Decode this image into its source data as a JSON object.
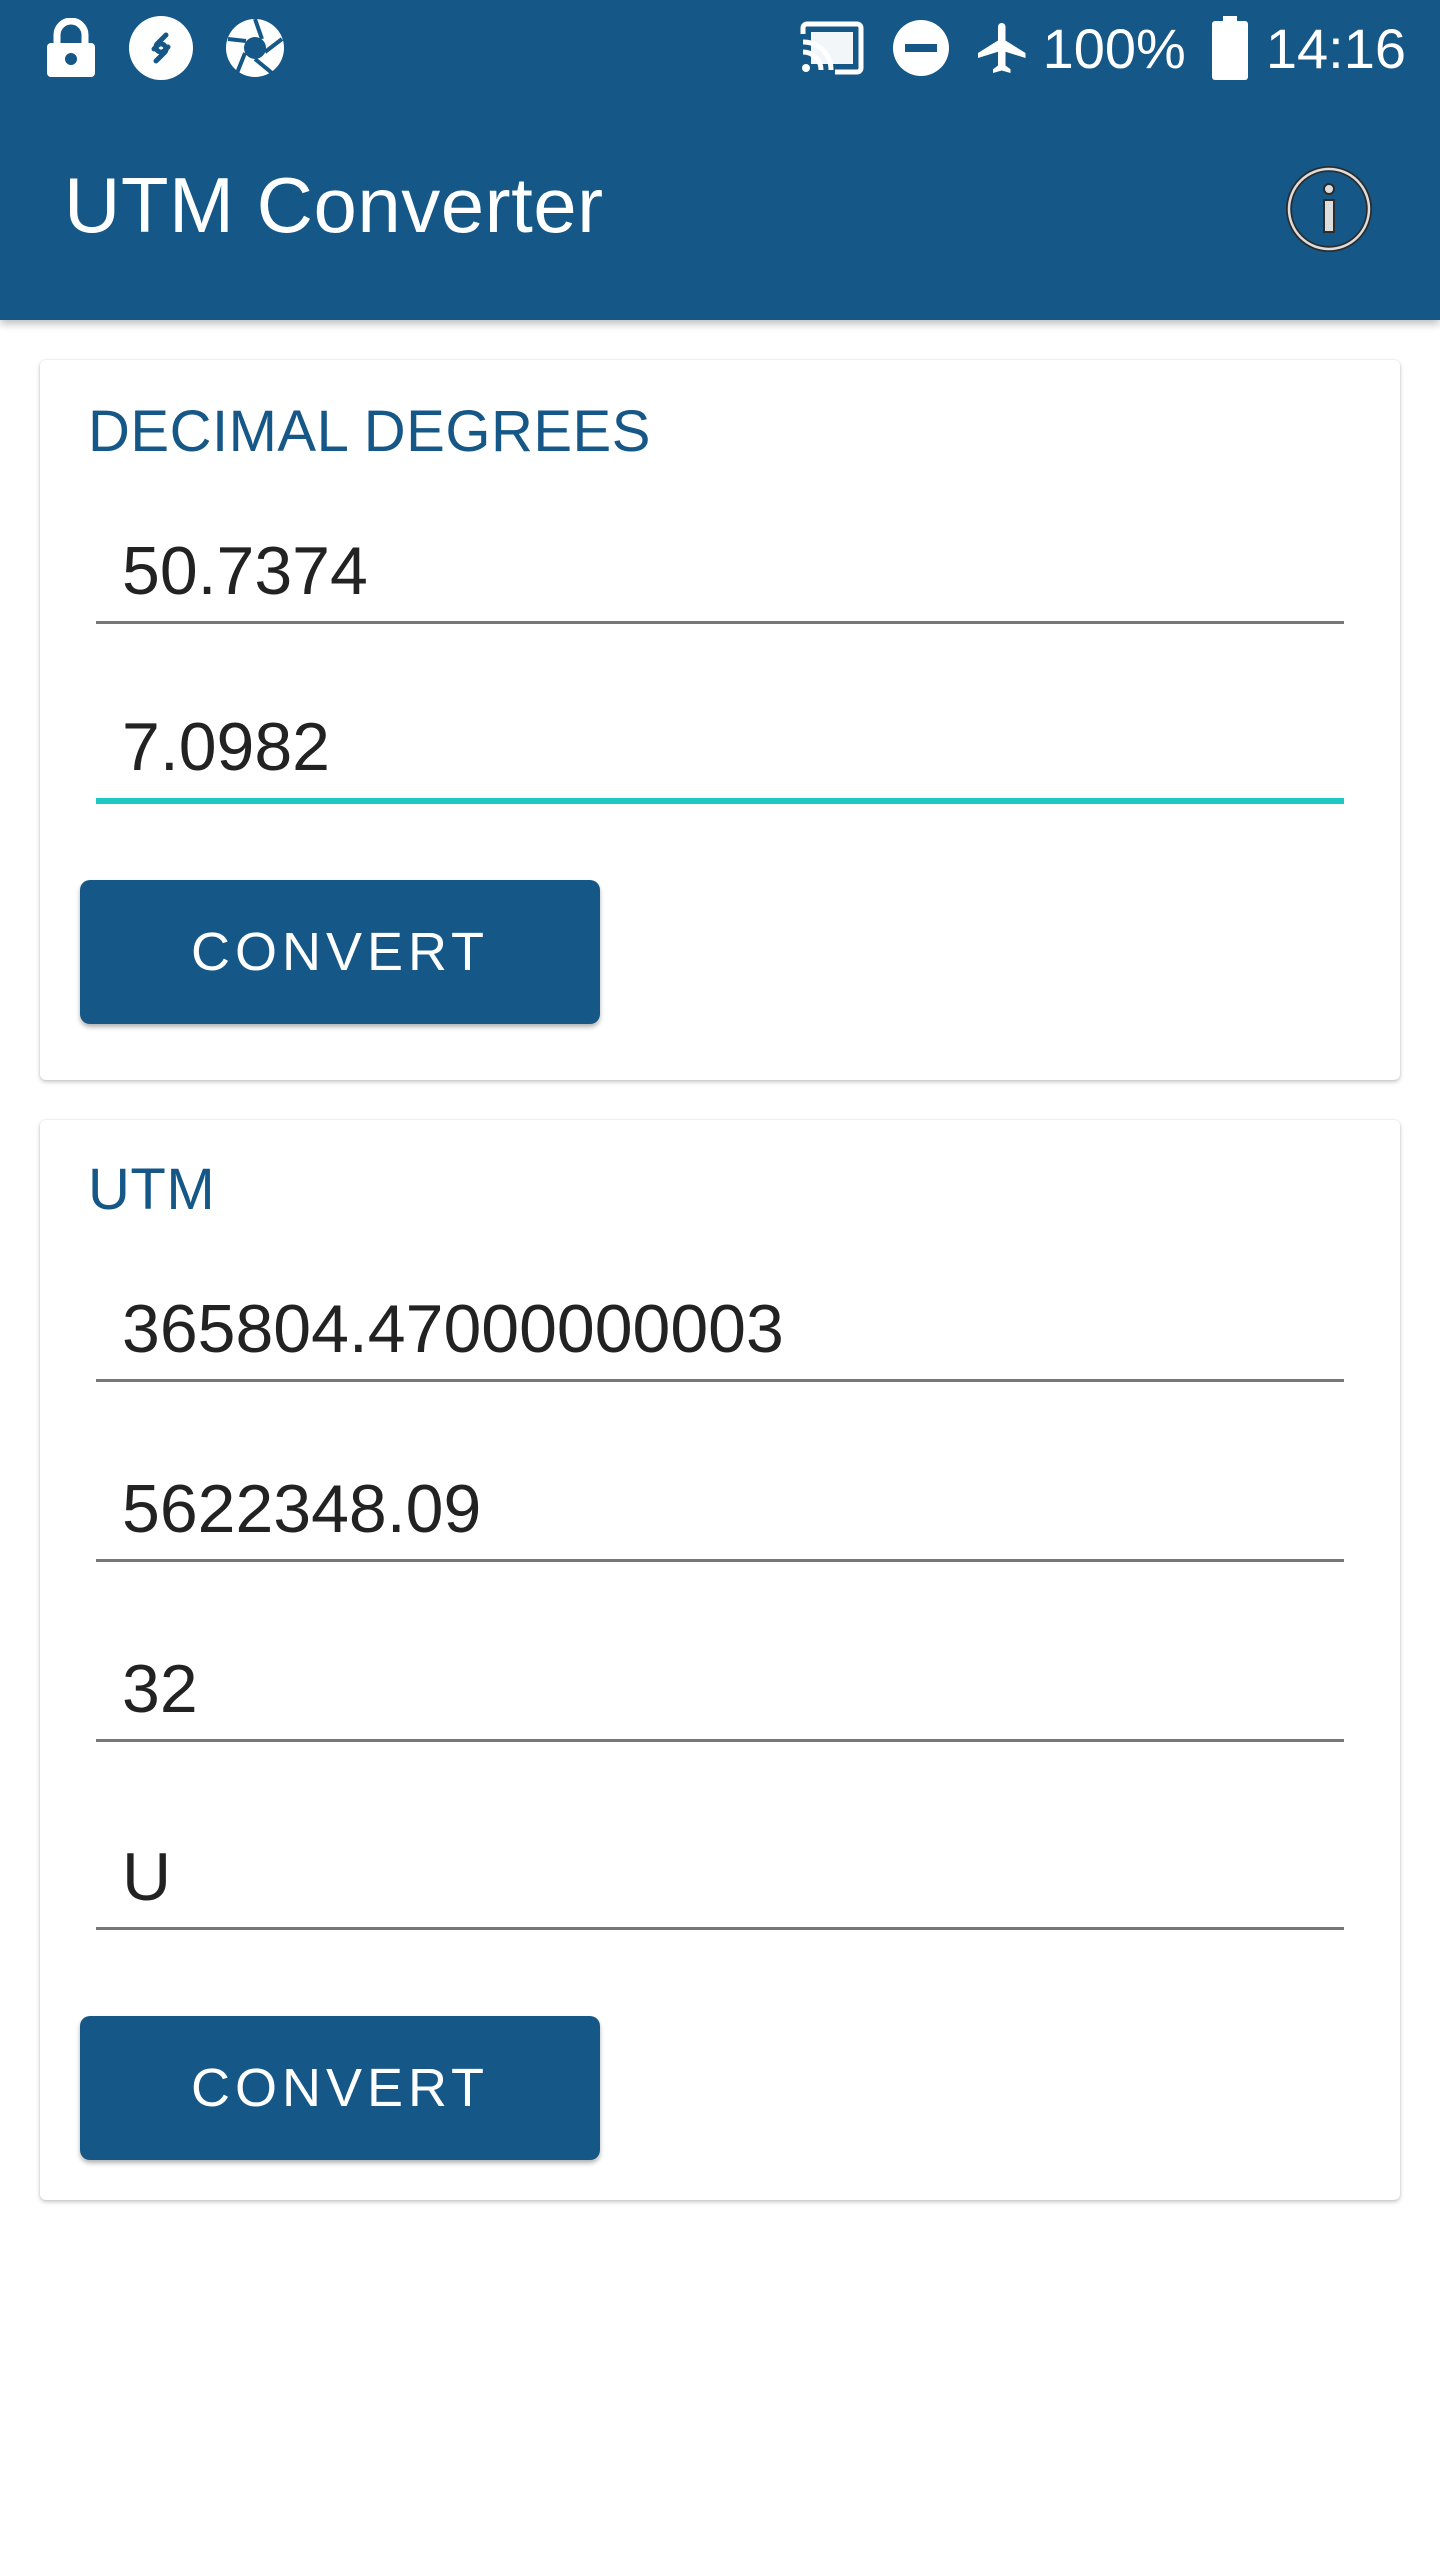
{
  "status_bar": {
    "icons_left": [
      "lock-icon",
      "shazam-icon",
      "shutter-icon"
    ],
    "icons_right": [
      "cast-icon",
      "do-not-disturb-icon",
      "airplane-mode-icon",
      "battery-icon"
    ],
    "battery_text": "100%",
    "time": "14:16"
  },
  "app_bar": {
    "title": "UTM Converter",
    "info_icon": "info-icon"
  },
  "decimal_card": {
    "title": "DECIMAL DEGREES",
    "latitude": "50.7374",
    "longitude": "7.0982",
    "convert_label": "CONVERT"
  },
  "utm_card": {
    "title": "UTM",
    "easting": "365804.47000000003",
    "northing": "5622348.09",
    "zone_number": "32",
    "zone_letter": "U",
    "convert_label": "CONVERT"
  },
  "colors": {
    "primary": "#155787",
    "accent": "#1dc9c0",
    "text": "#222222",
    "divider": "#777777"
  }
}
